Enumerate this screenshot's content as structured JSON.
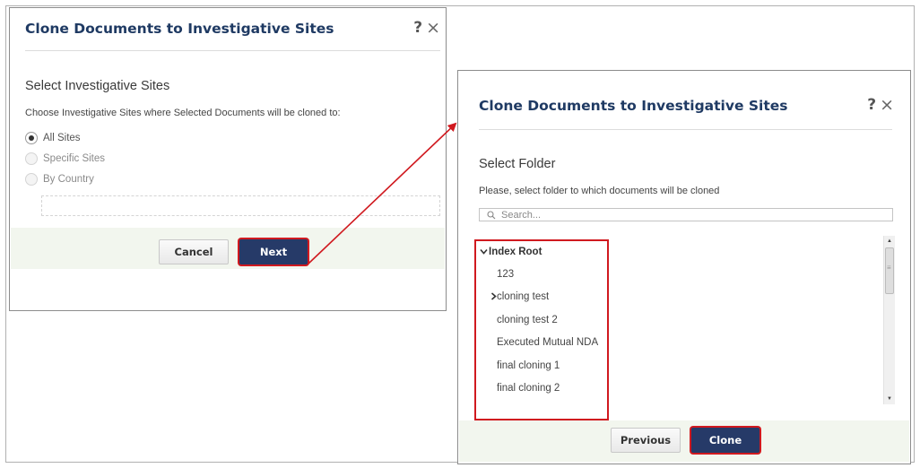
{
  "dialog1": {
    "title": "Clone Documents to Investigative Sites",
    "help_icon": "?",
    "close_icon": "×",
    "section_title": "Select Investigative Sites",
    "description": "Choose Investigative Sites where Selected Documents will be cloned to:",
    "options": [
      {
        "label": "All Sites",
        "checked": true,
        "disabled": false
      },
      {
        "label": "Specific Sites",
        "checked": false,
        "disabled": true
      },
      {
        "label": "By Country",
        "checked": false,
        "disabled": true
      }
    ],
    "cancel_label": "Cancel",
    "next_label": "Next"
  },
  "dialog2": {
    "title": "Clone Documents to Investigative Sites",
    "help_icon": "?",
    "close_icon": "×",
    "section_title": "Select Folder",
    "description": "Please, select folder to which documents will be cloned",
    "search_placeholder": "Search...",
    "tree": {
      "root": "Index Root",
      "items": [
        {
          "label": "123",
          "has_children": false
        },
        {
          "label": "cloning test",
          "has_children": true
        },
        {
          "label": "cloning test 2",
          "has_children": false
        },
        {
          "label": "Executed Mutual NDA",
          "has_children": false
        },
        {
          "label": "final cloning 1",
          "has_children": false
        },
        {
          "label": "final cloning 2",
          "has_children": false
        }
      ]
    },
    "previous_label": "Previous",
    "clone_label": "Clone"
  },
  "colors": {
    "title": "#1f3a63",
    "primary_button": "#263a68",
    "highlight": "#d0191f",
    "footer_band": "#f2f6ee"
  },
  "icons": {
    "help": "question-mark-icon",
    "close": "close-icon",
    "search": "magnifier-icon",
    "expanded": "chevron-down-icon",
    "collapsed": "chevron-right-icon"
  }
}
